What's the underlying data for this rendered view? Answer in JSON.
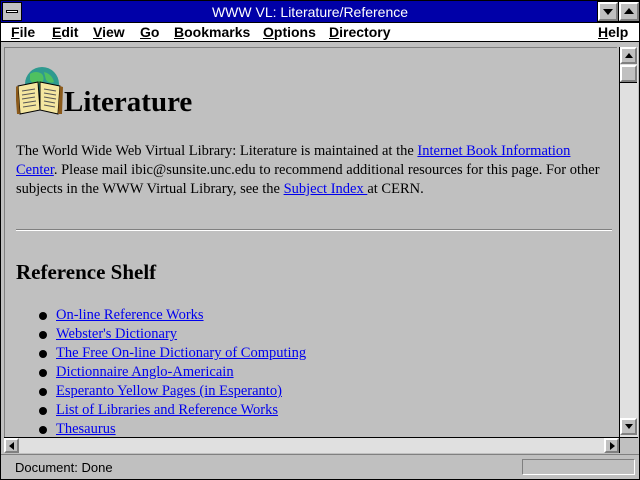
{
  "window": {
    "title": "WWW VL: Literature/Reference"
  },
  "menu": {
    "items": [
      {
        "label_u": "F",
        "label_rest": "ile"
      },
      {
        "label_u": "E",
        "label_rest": "dit"
      },
      {
        "label_u": "V",
        "label_rest": "iew"
      },
      {
        "label_u": "G",
        "label_rest": "o"
      },
      {
        "label_u": "B",
        "label_rest": "ookmarks"
      },
      {
        "label_u": "O",
        "label_rest": "ptions"
      },
      {
        "label_u": "D",
        "label_rest": "irectory"
      },
      {
        "label_u": "H",
        "label_rest": "elp"
      }
    ]
  },
  "page": {
    "heading": "Literature",
    "intro": {
      "t1": "The World Wide Web Virtual Library: Literature is maintained at the ",
      "link1": "Internet Book Information Center",
      "t2": ". Please mail ibic@sunsite.unc.edu to recommend additional resources for this page. For other subjects in the WWW Virtual Library, see the ",
      "link2": "Subject Index ",
      "t3": " at CERN."
    },
    "section_heading": "Reference Shelf",
    "shelf": [
      "On-line Reference Works ",
      "Webster's Dictionary ",
      "The Free On-line Dictionary of Computing ",
      "Dictionnaire Anglo-Americain ",
      "Esperanto Yellow Pages (in Esperanto) ",
      "List of Libraries and Reference Works ",
      "Thesaurus"
    ]
  },
  "status": {
    "text": "Document: Done"
  }
}
